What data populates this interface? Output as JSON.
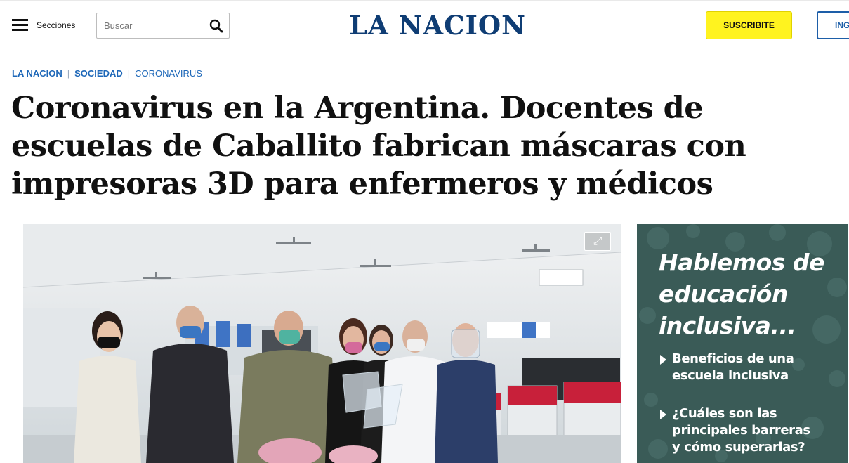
{
  "header": {
    "sections_label": "Secciones",
    "search_placeholder": "Buscar",
    "logo": "LA NACION",
    "subscribe_label": "SUSCRIBITE",
    "login_label": "ING"
  },
  "breadcrumb": {
    "items": [
      "LA NACION",
      "SOCIEDAD",
      "CORONAVIRUS"
    ],
    "separator": "|"
  },
  "article": {
    "headline": "Coronavirus en la Argentina. Docentes de escuelas de Caballito fabrican máscaras con impresoras 3D para enfermeros y médicos"
  },
  "photo": {
    "expand_icon": "expand-icon"
  },
  "ad": {
    "title": "Hablemos de educación inclusiva...",
    "items": [
      "Beneficios de una escuela inclusiva",
      "¿Cuáles son las principales barreras y cómo superarlas?"
    ]
  },
  "colors": {
    "brand": "#0f3d74",
    "link": "#1d67b8",
    "subscribe": "#fff31f",
    "ad_background": "#3a5b57"
  }
}
